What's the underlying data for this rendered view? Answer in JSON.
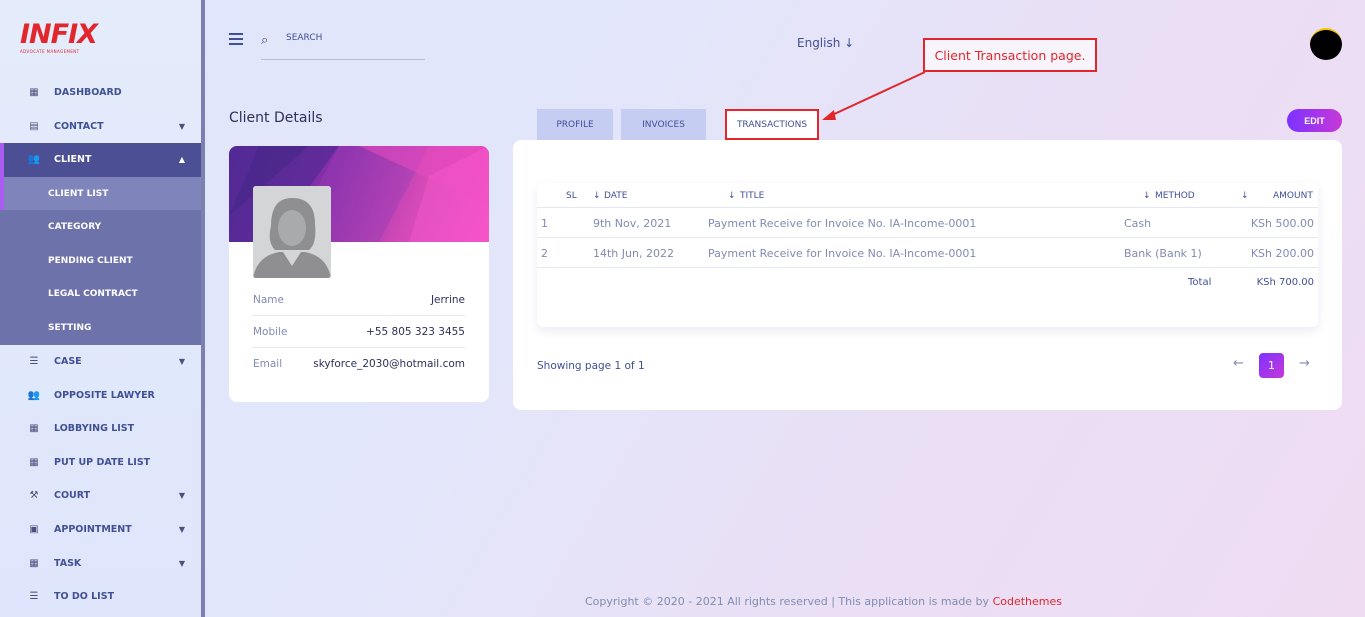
{
  "logo": {
    "mark": "INFIX",
    "sub": "ADVOCATE MANAGEMENT"
  },
  "sidebar": {
    "items": [
      {
        "label": "DASHBOARD",
        "icon": "grid-icon"
      },
      {
        "label": "CONTACT",
        "icon": "contact-book-icon",
        "caret": "▼"
      },
      {
        "label": "CLIENT",
        "icon": "users-icon",
        "caret": "▲"
      },
      {
        "label": "CASE",
        "icon": "list-icon",
        "caret": "▼"
      },
      {
        "label": "OPPOSITE LAWYER",
        "icon": "users-icon"
      },
      {
        "label": "LOBBYING LIST",
        "icon": "grid-icon"
      },
      {
        "label": "PUT UP DATE LIST",
        "icon": "grid-icon"
      },
      {
        "label": "COURT",
        "icon": "gavel-icon",
        "caret": "▼"
      },
      {
        "label": "APPOINTMENT",
        "icon": "calendar-icon",
        "caret": "▼"
      },
      {
        "label": "TASK",
        "icon": "grid-icon",
        "caret": "▼"
      },
      {
        "label": "TO DO LIST",
        "icon": "list-icon"
      }
    ],
    "client_sub": [
      "CLIENT LIST",
      "CATEGORY",
      "PENDING CLIENT",
      "LEGAL CONTRACT",
      "SETTING"
    ]
  },
  "header": {
    "search_placeholder": "SEARCH",
    "language": "English"
  },
  "annotation": "Client Transaction page.",
  "page_title": "Client Details",
  "profile": {
    "name_label": "Name",
    "name": "Jerrine",
    "mobile_label": "Mobile",
    "mobile": "+55 805 323 3455",
    "email_label": "Email",
    "email": "skyforce_2030@hotmail.com"
  },
  "tabs": [
    "PROFILE",
    "INVOICES",
    "TRANSACTIONS"
  ],
  "edit_label": "EDIT",
  "table": {
    "headers": [
      "SL",
      "DATE",
      "TITLE",
      "METHOD",
      "AMOUNT"
    ],
    "rows": [
      [
        "1",
        "9th Nov, 2021",
        "Payment Receive for Invoice No. IA-Income-0001",
        "Cash",
        "KSh 500.00"
      ],
      [
        "2",
        "14th Jun, 2022",
        "Payment Receive for Invoice No. IA-Income-0001",
        "Bank (Bank 1)",
        "KSh 200.00"
      ]
    ],
    "total_label": "Total",
    "total_value": "KSh 700.00"
  },
  "pagination": {
    "showing": "Showing page 1 of 1",
    "current": "1"
  },
  "footer": {
    "text": "Copyright © 2020 - 2021 All rights reserved | This application is made by ",
    "brand": "Codethemes"
  },
  "colors": {
    "accent": "#7c32ff",
    "brand_red": "#e1262c",
    "sidebar_active": "#4c4f93"
  }
}
